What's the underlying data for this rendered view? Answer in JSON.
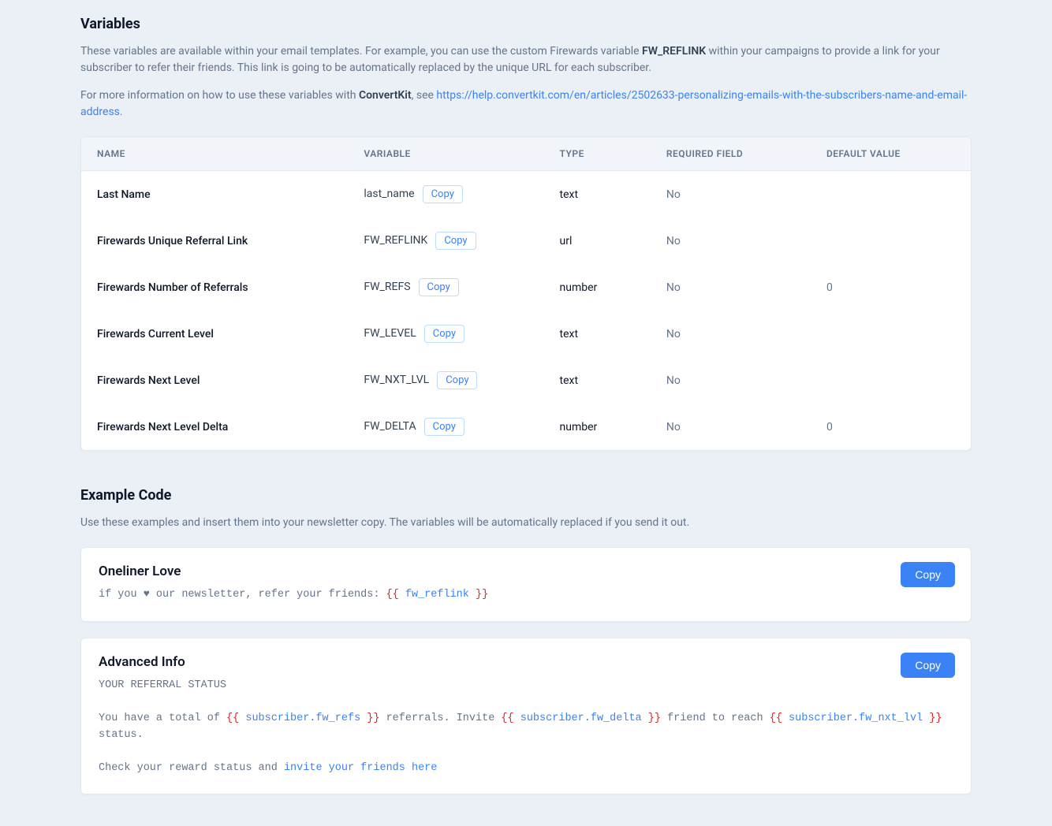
{
  "variables_section": {
    "title": "Variables",
    "intro_prefix": "These variables are available within your email templates. For example, you can use the custom Firewards variable ",
    "intro_bold": "FW_REFLINK",
    "intro_suffix": " within your campaigns to provide a link for your subscriber to refer their friends. This link is going to be automatically replaced by the unique URL for each subscriber.",
    "moreinfo_prefix": "For more information on how to use these variables with ",
    "moreinfo_bold": "ConvertKit",
    "moreinfo_mid": ", see ",
    "moreinfo_link": "https://help.convertkit.com/en/articles/2502633-personalizing-emails-with-the-subscribers-name-and-email-address",
    "moreinfo_tail": ".",
    "table": {
      "headers": {
        "name": "NAME",
        "variable": "VARIABLE",
        "type": "TYPE",
        "required": "REQUIRED FIELD",
        "default": "DEFAULT VALUE"
      },
      "copy_label": "Copy",
      "rows": [
        {
          "name": "Last Name",
          "variable": "last_name",
          "type": "text",
          "required": "No",
          "default": ""
        },
        {
          "name": "Firewards Unique Referral Link",
          "variable": "FW_REFLINK",
          "type": "url",
          "required": "No",
          "default": ""
        },
        {
          "name": "Firewards Number of Referrals",
          "variable": "FW_REFS",
          "type": "number",
          "required": "No",
          "default": "0"
        },
        {
          "name": "Firewards Current Level",
          "variable": "FW_LEVEL",
          "type": "text",
          "required": "No",
          "default": ""
        },
        {
          "name": "Firewards Next Level",
          "variable": "FW_NXT_LVL",
          "type": "text",
          "required": "No",
          "default": ""
        },
        {
          "name": "Firewards Next Level Delta",
          "variable": "FW_DELTA",
          "type": "number",
          "required": "No",
          "default": "0"
        }
      ]
    }
  },
  "example_section": {
    "title": "Example Code",
    "intro": "Use these examples and insert them into your newsletter copy. The variables will be automatically replaced if you send it out.",
    "copy_label": "Copy",
    "examples": [
      {
        "title": "Oneliner Love",
        "tokens": [
          {
            "t": "plain",
            "v": "if you ♥ our newsletter, refer your friends: "
          },
          {
            "t": "red",
            "v": "{{ "
          },
          {
            "t": "blue",
            "v": "fw_reflink"
          },
          {
            "t": "red",
            "v": " }}"
          }
        ]
      },
      {
        "title": "Advanced Info",
        "tokens": [
          {
            "t": "plain",
            "v": "YOUR REFERRAL STATUS\n\nYou have a total of "
          },
          {
            "t": "red",
            "v": "{{ "
          },
          {
            "t": "blue",
            "v": "subscriber.fw_refs"
          },
          {
            "t": "red",
            "v": " }}"
          },
          {
            "t": "plain",
            "v": " referrals. Invite "
          },
          {
            "t": "red",
            "v": "{{ "
          },
          {
            "t": "blue",
            "v": "subscriber.fw_delta"
          },
          {
            "t": "red",
            "v": " }}"
          },
          {
            "t": "plain",
            "v": " friend to reach "
          },
          {
            "t": "red",
            "v": "{{ "
          },
          {
            "t": "blue",
            "v": "subscriber.fw_nxt_lvl"
          },
          {
            "t": "red",
            "v": " }}"
          },
          {
            "t": "plain",
            "v": " status.\n\nCheck your reward status and "
          },
          {
            "t": "blue",
            "v": "invite your friends here"
          }
        ]
      }
    ]
  }
}
